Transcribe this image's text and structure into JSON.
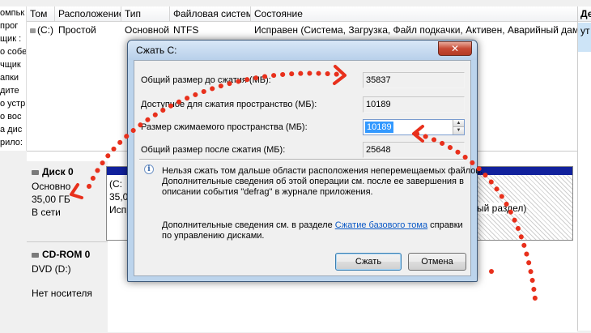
{
  "volume_table": {
    "columns": [
      "Том",
      "Расположение",
      "Тип",
      "Файловая система",
      "Состояние"
    ],
    "row": {
      "volume": "(C:)",
      "location": "Простой",
      "type": "Основной",
      "filesystem": "NTFS",
      "status": "Исправен (Система, Загрузка, Файл подкачки, Активен, Аварийный дамп памя"
    },
    "left_clipped_text": [
      "омпьк",
      "прог",
      "щик :",
      "о собе",
      "чщик",
      "апки",
      "дите",
      "о устр",
      "о вос",
      "а дис",
      "рило:"
    ]
  },
  "actions_pane": {
    "header": "Де",
    "item": "ут"
  },
  "disks": [
    {
      "name": "Диск 0",
      "kind": "Основно",
      "size": "35,00 ГБ",
      "state": "В сети"
    },
    {
      "name": "CD-ROM 0",
      "kind": "DVD (D:)",
      "size": "",
      "state": "Нет носителя"
    }
  ],
  "partition_c": {
    "name": "(C:",
    "size": "35,0",
    "status": "Испр"
  },
  "partition_reserved_label": "ый раздел)",
  "dialog": {
    "title": "Сжать C:",
    "close_glyph": "✕",
    "fields": [
      {
        "label": "Общий размер до сжатия (МБ):",
        "value": "35837"
      },
      {
        "label": "Доступное для сжатия пространство (МБ):",
        "value": "10189"
      },
      {
        "label": "Размер сжимаемого пространства (МБ):",
        "value": "10189"
      },
      {
        "label": "Общий размер после сжатия (МБ):",
        "value": "25648"
      }
    ],
    "info_icon": "i",
    "info_lines": [
      "Нельзя сжать том дальше области расположения неперемещаемых файлов.",
      "Дополнительные сведения об этой операции см. после ее завершения в",
      "описании события \"defrag\" в журнале приложения."
    ],
    "help_prefix": "Дополнительные сведения см. в разделе ",
    "help_link": "Сжатие базового тома",
    "help_suffix": " справки",
    "help_line2": "по управлению дисками.",
    "shrink_label": "Сжать",
    "cancel_label": "Отмена"
  },
  "colors": {
    "annotation_red": "#e8301c",
    "partition_bar": "#11219c",
    "selection": "#3399ff"
  }
}
